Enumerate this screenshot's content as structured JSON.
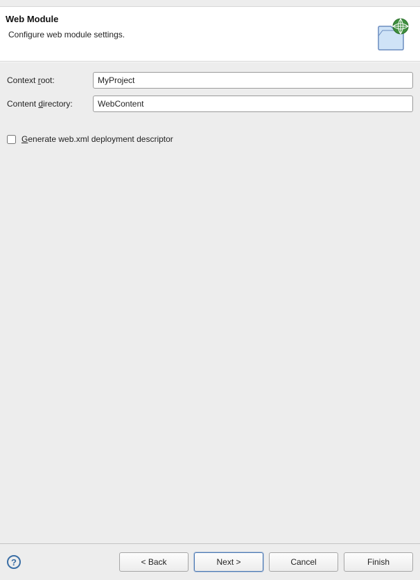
{
  "header": {
    "title": "Web Module",
    "description": "Configure web module settings."
  },
  "fields": {
    "context_root": {
      "label_pre": "Context ",
      "label_u": "r",
      "label_post": "oot:",
      "value": "MyProject"
    },
    "content_directory": {
      "label_pre": "Content ",
      "label_u": "d",
      "label_post": "irectory:",
      "value": "WebContent"
    }
  },
  "checkbox": {
    "generate_webxml": {
      "checked": false,
      "label_u": "G",
      "label_post": "enerate web.xml deployment descriptor"
    }
  },
  "buttons": {
    "back": "< Back",
    "next": "Next >",
    "cancel": "Cancel",
    "finish": "Finish"
  },
  "help_glyph": "?"
}
